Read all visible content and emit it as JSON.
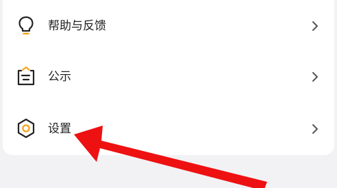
{
  "menu": {
    "items": [
      {
        "label": "帮助与反馈",
        "icon": "lightbulb-icon"
      },
      {
        "label": "公示",
        "icon": "notice-board-icon"
      },
      {
        "label": "设置",
        "icon": "settings-hexagon-icon"
      }
    ],
    "chevron_icon": "chevron-right-icon"
  },
  "annotation": {
    "icon": "red-arrow-icon",
    "target": "设置",
    "color": "#ee1111"
  },
  "colors": {
    "accent": "#f5a623",
    "icon_stroke": "#222222",
    "background": "#f2f2f4",
    "card": "#ffffff"
  }
}
